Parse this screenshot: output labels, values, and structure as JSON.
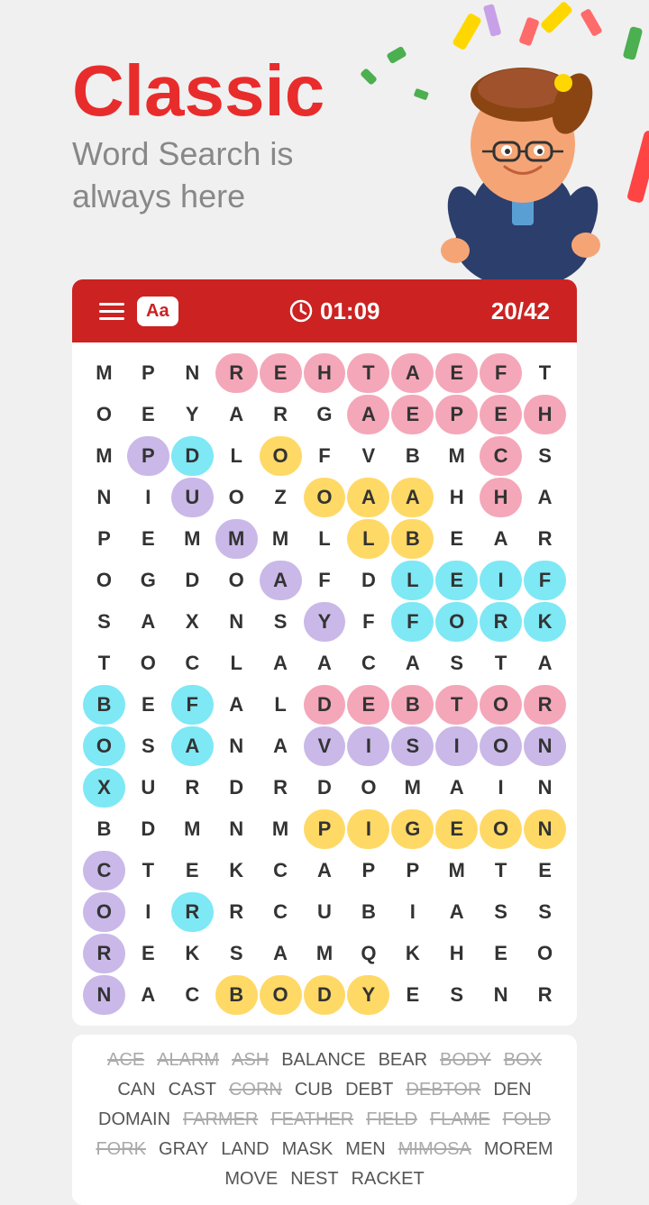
{
  "hero": {
    "title": "Classic",
    "subtitle_line1": "Word Search is",
    "subtitle_line2": "always here"
  },
  "toolbar": {
    "font_label": "Aa",
    "timer": "01:09",
    "score": "20/42"
  },
  "grid": {
    "cells": [
      [
        "M",
        "P",
        "N",
        "R",
        "E",
        "H",
        "T",
        "A",
        "E",
        "F",
        "T"
      ],
      [
        "O",
        "E",
        "Y",
        "A",
        "R",
        "G",
        "A",
        "E",
        "P",
        "E",
        "H"
      ],
      [
        "M",
        "P",
        "D",
        "L",
        "O",
        "F",
        "V",
        "B",
        "M",
        "C",
        "S"
      ],
      [
        "N",
        "I",
        "U",
        "O",
        "Z",
        "O",
        "A",
        "A",
        "H",
        "H",
        "A"
      ],
      [
        "P",
        "E",
        "M",
        "M",
        "M",
        "L",
        "L",
        "B",
        "E",
        "A",
        "R"
      ],
      [
        "O",
        "G",
        "D",
        "O",
        "A",
        "F",
        "D",
        "L",
        "E",
        "I",
        "F"
      ],
      [
        "S",
        "A",
        "X",
        "N",
        "S",
        "Y",
        "F",
        "F",
        "O",
        "R",
        "K"
      ],
      [
        "T",
        "O",
        "C",
        "L",
        "A",
        "A",
        "C",
        "A",
        "S",
        "T",
        "A"
      ],
      [
        "B",
        "E",
        "F",
        "A",
        "L",
        "D",
        "E",
        "B",
        "T",
        "O",
        "R"
      ],
      [
        "O",
        "S",
        "A",
        "N",
        "A",
        "V",
        "I",
        "S",
        "I",
        "O",
        "N"
      ],
      [
        "X",
        "U",
        "R",
        "D",
        "R",
        "D",
        "O",
        "M",
        "A",
        "I",
        "N"
      ],
      [
        "B",
        "D",
        "M",
        "N",
        "M",
        "P",
        "I",
        "G",
        "E",
        "O",
        "N"
      ],
      [
        "C",
        "T",
        "E",
        "K",
        "C",
        "A",
        "P",
        "P",
        "M",
        "T",
        "E"
      ],
      [
        "O",
        "I",
        "R",
        "R",
        "C",
        "U",
        "B",
        "I",
        "A",
        "S",
        "S"
      ],
      [
        "R",
        "E",
        "K",
        "S",
        "A",
        "M",
        "Q",
        "K",
        "H",
        "E",
        "O"
      ],
      [
        "N",
        "A",
        "C",
        "B",
        "O",
        "D",
        "Y",
        "E",
        "S",
        "N",
        "R"
      ]
    ],
    "highlights": {
      "rehtaef": {
        "cells": [
          [
            0,
            3
          ],
          [
            0,
            4
          ],
          [
            0,
            5
          ],
          [
            0,
            6
          ],
          [
            0,
            7
          ],
          [
            0,
            8
          ],
          [
            0,
            9
          ]
        ],
        "color": "hl-pink"
      },
      "aep": {
        "cells": [
          [
            1,
            6
          ],
          [
            1,
            7
          ],
          [
            1,
            8
          ]
        ],
        "color": "hl-pink"
      },
      "eh": {
        "cells": [
          [
            1,
            9
          ],
          [
            1,
            10
          ]
        ],
        "color": "hl-pink"
      },
      "pd": {
        "cells": [
          [
            2,
            1
          ],
          [
            2,
            2
          ]
        ],
        "color": "hl-cyan"
      },
      "vision": {
        "cells": [
          [
            9,
            5
          ],
          [
            9,
            6
          ],
          [
            9,
            7
          ],
          [
            9,
            8
          ],
          [
            9,
            9
          ],
          [
            9,
            10
          ]
        ],
        "color": "hl-purple"
      },
      "debtor": {
        "cells": [
          [
            8,
            5
          ],
          [
            8,
            6
          ],
          [
            8,
            7
          ],
          [
            8,
            8
          ],
          [
            8,
            9
          ],
          [
            8,
            10
          ]
        ],
        "color": "hl-pink"
      },
      "b_col": {
        "cells": [
          [
            8,
            0
          ],
          [
            9,
            0
          ],
          [
            10,
            0
          ]
        ],
        "color": "hl-cyan"
      },
      "a_col": {
        "cells": [
          [
            8,
            2
          ],
          [
            9,
            2
          ]
        ],
        "color": "hl-cyan"
      },
      "pigeon": {
        "cells": [
          [
            11,
            5
          ],
          [
            11,
            6
          ],
          [
            11,
            7
          ],
          [
            11,
            8
          ],
          [
            11,
            9
          ],
          [
            11,
            10
          ]
        ],
        "color": "hl-yellow"
      },
      "fork": {
        "cells": [
          [
            6,
            7
          ],
          [
            6,
            8
          ],
          [
            6,
            9
          ],
          [
            6,
            10
          ]
        ],
        "color": "hl-cyan"
      },
      "leaf": {
        "cells": [
          [
            4,
            7
          ],
          [
            5,
            7
          ],
          [
            6,
            7
          ]
        ],
        "color": "hl-yellow"
      },
      "body": {
        "cells": [
          [
            15,
            3
          ],
          [
            15,
            4
          ],
          [
            15,
            5
          ],
          [
            15,
            6
          ]
        ],
        "color": "hl-yellow"
      },
      "c_col": {
        "cells": [
          [
            12,
            0
          ],
          [
            13,
            0
          ],
          [
            14,
            0
          ],
          [
            15,
            0
          ]
        ],
        "color": "hl-purple"
      },
      "r_col": {
        "cells": [
          [
            13,
            2
          ]
        ],
        "color": "hl-cyan"
      },
      "leif": {
        "cells": [
          [
            5,
            7
          ],
          [
            5,
            8
          ],
          [
            5,
            9
          ],
          [
            5,
            10
          ]
        ],
        "color": "hl-cyan"
      },
      "e_col": {
        "cells": [
          [
            2,
            9
          ],
          [
            3,
            9
          ]
        ],
        "color": "hl-pink"
      }
    }
  },
  "words": [
    {
      "text": "ACE",
      "done": true
    },
    {
      "text": "ALARM",
      "done": true
    },
    {
      "text": "ASH",
      "done": true
    },
    {
      "text": "BALANCE",
      "done": false
    },
    {
      "text": "BEAR",
      "done": false
    },
    {
      "text": "BODY",
      "done": true
    },
    {
      "text": "BOX",
      "done": true
    },
    {
      "text": "CAN",
      "done": false
    },
    {
      "text": "CAST",
      "done": false
    },
    {
      "text": "CORN",
      "done": true
    },
    {
      "text": "CUB",
      "done": false
    },
    {
      "text": "DEBT",
      "done": false
    },
    {
      "text": "DEBTOR",
      "done": true
    },
    {
      "text": "DEN",
      "done": false
    },
    {
      "text": "DOMAIN",
      "done": false
    },
    {
      "text": "FARMER",
      "done": true
    },
    {
      "text": "FEATHER",
      "done": true
    },
    {
      "text": "FIELD",
      "done": true
    },
    {
      "text": "FLAME",
      "done": true
    },
    {
      "text": "FOLD",
      "done": true
    },
    {
      "text": "FORK",
      "done": true
    },
    {
      "text": "GRAY",
      "done": false
    },
    {
      "text": "LAND",
      "done": false
    },
    {
      "text": "MASK",
      "done": false
    },
    {
      "text": "MEN",
      "done": false
    },
    {
      "text": "MIMOSA",
      "done": true
    },
    {
      "text": "MOREM",
      "done": false
    },
    {
      "text": "MOVE",
      "done": false
    },
    {
      "text": "NEST",
      "done": false
    },
    {
      "text": "RACKET",
      "done": false
    }
  ]
}
